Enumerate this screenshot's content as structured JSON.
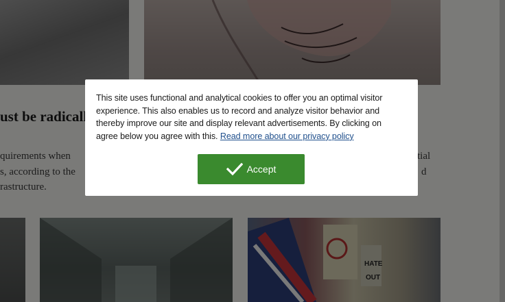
{
  "background": {
    "headline": "ust be radicall",
    "teaser_lines": [
      "quirements when",
      "s, according to the",
      "rastructure."
    ],
    "teaser_right_fragments": [
      "tial",
      "d"
    ]
  },
  "cookie_dialog": {
    "message": "This site uses functional and analytical cookies to offer you an optimal visitor experience. This also enables us to record and analyze visitor behavior and thereby improve our site and display relevant advertisements. By clicking on agree below you agree with this.",
    "privacy_link_label": "Read more about our privacy policy",
    "accept_label": "Accept",
    "accept_icon": "checkmark-icon"
  },
  "colors": {
    "accept_button": "#3a8a2e",
    "link": "#1f4f8c",
    "overlay": "rgba(0,0,0,0.5)"
  }
}
